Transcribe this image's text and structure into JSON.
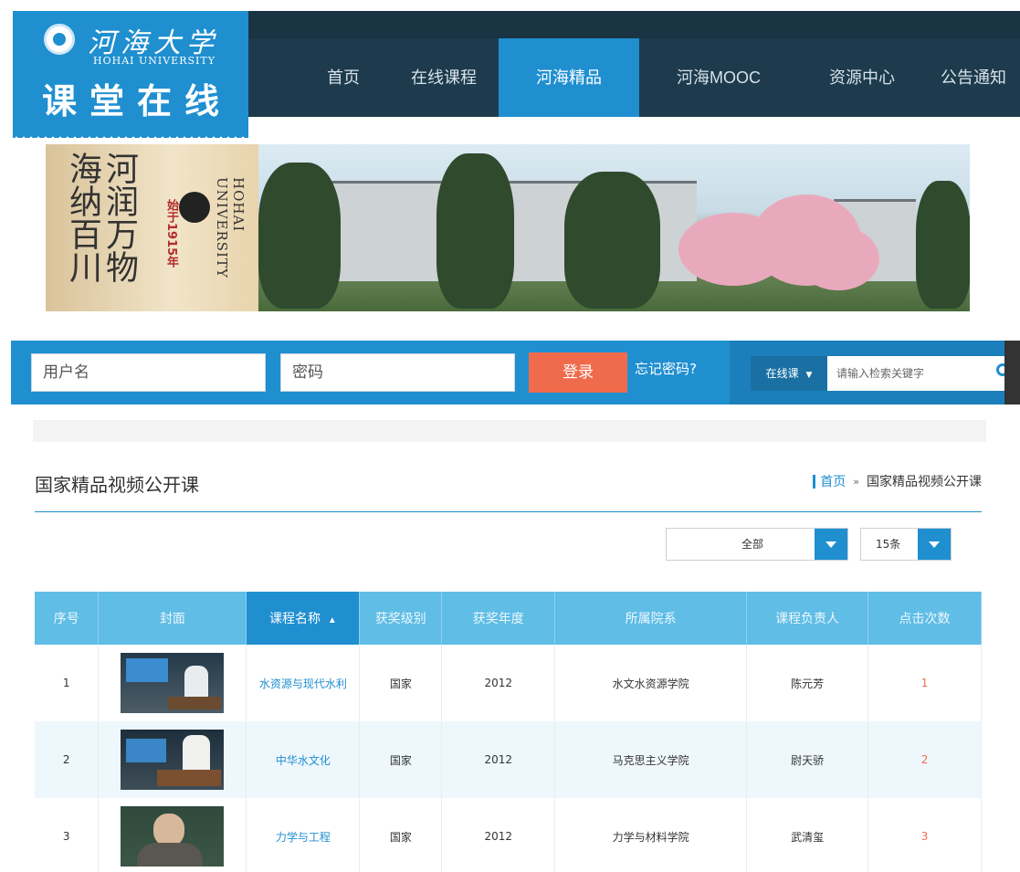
{
  "header": {
    "logo": {
      "school_name": "河海大学",
      "school_name_en": "HOHAI UNIVERSITY",
      "site_title": "课堂在线"
    },
    "nav": [
      {
        "label": "首页",
        "active": false
      },
      {
        "label": "在线课程",
        "active": false
      },
      {
        "label": "河海精品",
        "active": true
      },
      {
        "label": "河海MOOC",
        "active": false
      },
      {
        "label": "资源中心",
        "active": false
      },
      {
        "label": "公告通知",
        "active": false
      }
    ],
    "colors": {
      "header_bg": "#1d3b4c",
      "accent": "#1f8fd0"
    }
  },
  "banner": {
    "motto": "河润万物 海纳百川",
    "since": "始于1915年",
    "school_en": "HOHAI UNIVERSITY"
  },
  "login": {
    "username_placeholder": "用户名",
    "password_placeholder": "密码",
    "login_label": "登录",
    "forgot_label": "忘记密码?",
    "login_color": "#f06b4c"
  },
  "search": {
    "type_label": "在线课",
    "placeholder": "请输入检索关键字",
    "icon": "search-icon"
  },
  "page": {
    "title": "国家精品视频公开课",
    "breadcrumb": {
      "home": "首页",
      "separator": "»",
      "current": "国家精品视频公开课"
    }
  },
  "filters": {
    "category": "全部",
    "page_size": "15条"
  },
  "table": {
    "columns": [
      "序号",
      "封面",
      "课程名称",
      "获奖级别",
      "获奖年度",
      "所属院系",
      "课程负责人",
      "点击次数"
    ],
    "sort_indicator": "▲",
    "rows": [
      {
        "index": "1",
        "name": "水资源与现代水利",
        "level": "国家",
        "year": "2012",
        "department": "水文水资源学院",
        "lead": "陈元芳",
        "clicks": "1"
      },
      {
        "index": "2",
        "name": "中华水文化",
        "level": "国家",
        "year": "2012",
        "department": "马克思主义学院",
        "lead": "尉天骄",
        "clicks": "2"
      },
      {
        "index": "3",
        "name": "力学与工程",
        "level": "国家",
        "year": "2012",
        "department": "力学与材料学院",
        "lead": "武清玺",
        "clicks": "3"
      }
    ]
  }
}
